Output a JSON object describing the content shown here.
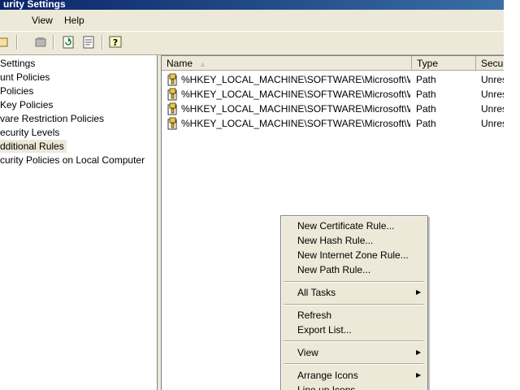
{
  "window": {
    "title": "urity Settings"
  },
  "menubar": {
    "items": [
      "View",
      "Help"
    ]
  },
  "toolbar": {
    "icons": [
      "up-icon",
      "properties-icon",
      "refresh-icon",
      "export-list-icon",
      "help-icon"
    ]
  },
  "tree": {
    "items": [
      {
        "label": "Settings"
      },
      {
        "label": "unt Policies"
      },
      {
        "label": "Policies"
      },
      {
        "label": " Key Policies"
      },
      {
        "label": "vare Restriction Policies"
      },
      {
        "label": "ecurity Levels"
      },
      {
        "label": "dditional Rules",
        "selected": true
      },
      {
        "label": "curity Policies on Local Computer"
      }
    ]
  },
  "list": {
    "columns": [
      {
        "label": "Name"
      },
      {
        "label": "Type"
      },
      {
        "label": "Secur"
      }
    ],
    "rows": [
      {
        "name": "%HKEY_LOCAL_MACHINE\\SOFTWARE\\Microsoft\\Wi...",
        "type": "Path",
        "security": "Unres"
      },
      {
        "name": "%HKEY_LOCAL_MACHINE\\SOFTWARE\\Microsoft\\Wi...",
        "type": "Path",
        "security": "Unres"
      },
      {
        "name": "%HKEY_LOCAL_MACHINE\\SOFTWARE\\Microsoft\\Wi...",
        "type": "Path",
        "security": "Unres"
      },
      {
        "name": "%HKEY_LOCAL_MACHINE\\SOFTWARE\\Microsoft\\Wi...",
        "type": "Path",
        "security": "Unres"
      }
    ]
  },
  "context_menu": {
    "items": [
      {
        "label": "New Certificate Rule..."
      },
      {
        "label": "New Hash Rule..."
      },
      {
        "label": "New Internet Zone Rule..."
      },
      {
        "label": "New Path Rule..."
      },
      {
        "label": "All Tasks",
        "submenu": true
      },
      {
        "label": "Refresh"
      },
      {
        "label": "Export List..."
      },
      {
        "label": "View",
        "submenu": true
      },
      {
        "label": "Arrange Icons",
        "submenu": true
      },
      {
        "label": "Line up Icons"
      }
    ]
  }
}
